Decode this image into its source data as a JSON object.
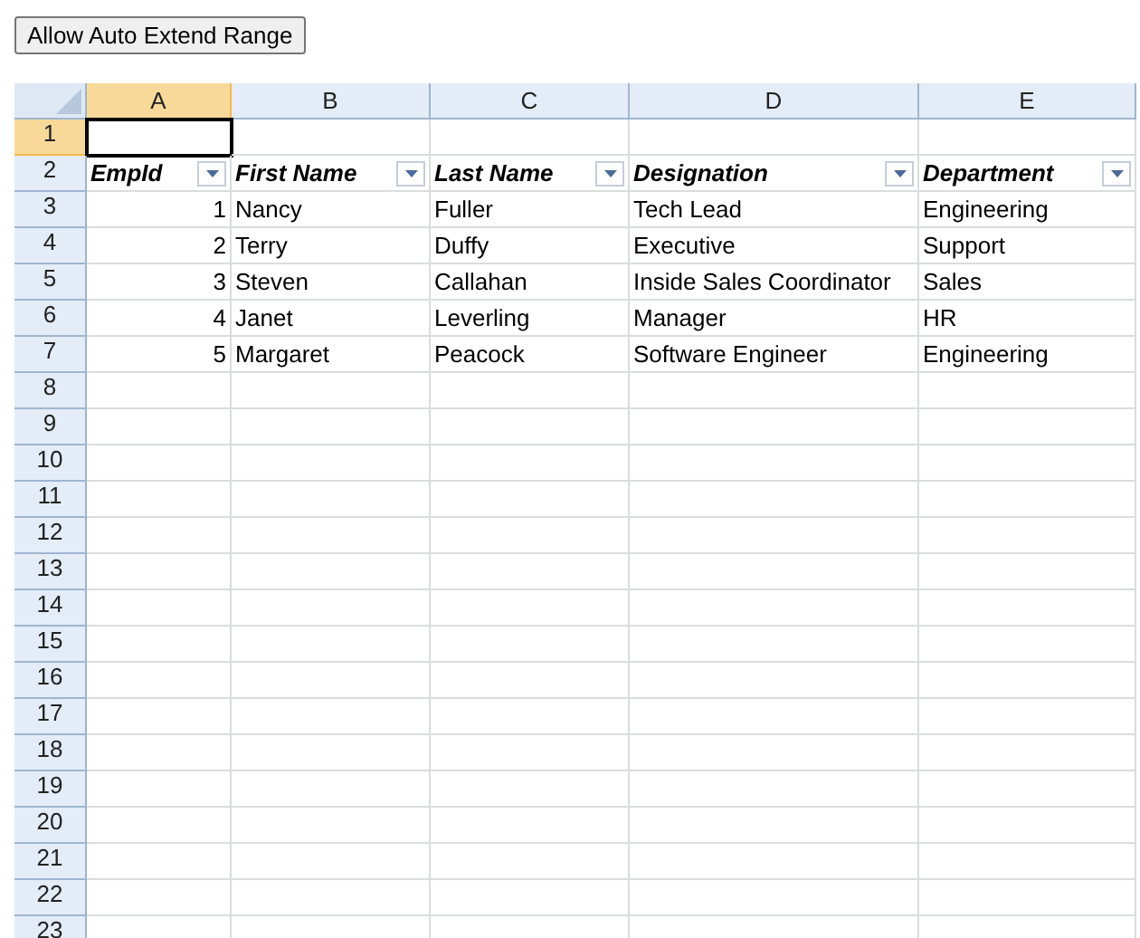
{
  "button": {
    "label": "Allow Auto Extend Range"
  },
  "sheet": {
    "columns": [
      {
        "label": "A",
        "selected": true
      },
      {
        "label": "B",
        "selected": false
      },
      {
        "label": "C",
        "selected": false
      },
      {
        "label": "D",
        "selected": false
      },
      {
        "label": "E",
        "selected": false
      }
    ],
    "rows": [
      {
        "label": "1",
        "selected": true,
        "kind": "empty"
      },
      {
        "label": "2",
        "selected": false,
        "kind": "header",
        "cells": [
          "EmpId",
          "First Name",
          "Last Name",
          "Designation",
          "Department"
        ]
      },
      {
        "label": "3",
        "selected": false,
        "kind": "data",
        "cells": [
          "1",
          "Nancy",
          "Fuller",
          "Tech Lead",
          "Engineering"
        ]
      },
      {
        "label": "4",
        "selected": false,
        "kind": "data",
        "cells": [
          "2",
          "Terry",
          "Duffy",
          "Executive",
          "Support"
        ]
      },
      {
        "label": "5",
        "selected": false,
        "kind": "data",
        "cells": [
          "3",
          "Steven",
          "Callahan",
          "Inside Sales Coordinator",
          "Sales"
        ]
      },
      {
        "label": "6",
        "selected": false,
        "kind": "data",
        "cells": [
          "4",
          "Janet",
          "Leverling",
          "Manager",
          "HR"
        ]
      },
      {
        "label": "7",
        "selected": false,
        "kind": "data",
        "cells": [
          "5",
          "Margaret",
          "Peacock",
          "Software Engineer",
          "Engineering"
        ]
      },
      {
        "label": "8",
        "selected": false,
        "kind": "empty"
      },
      {
        "label": "9",
        "selected": false,
        "kind": "empty"
      },
      {
        "label": "10",
        "selected": false,
        "kind": "empty"
      },
      {
        "label": "11",
        "selected": false,
        "kind": "empty"
      },
      {
        "label": "12",
        "selected": false,
        "kind": "empty"
      },
      {
        "label": "13",
        "selected": false,
        "kind": "empty"
      },
      {
        "label": "14",
        "selected": false,
        "kind": "empty"
      },
      {
        "label": "15",
        "selected": false,
        "kind": "empty"
      },
      {
        "label": "16",
        "selected": false,
        "kind": "empty"
      },
      {
        "label": "17",
        "selected": false,
        "kind": "empty"
      },
      {
        "label": "18",
        "selected": false,
        "kind": "empty"
      },
      {
        "label": "19",
        "selected": false,
        "kind": "empty"
      },
      {
        "label": "20",
        "selected": false,
        "kind": "empty"
      },
      {
        "label": "21",
        "selected": false,
        "kind": "empty"
      },
      {
        "label": "22",
        "selected": false,
        "kind": "empty"
      },
      {
        "label": "23",
        "selected": false,
        "kind": "empty"
      }
    ]
  }
}
